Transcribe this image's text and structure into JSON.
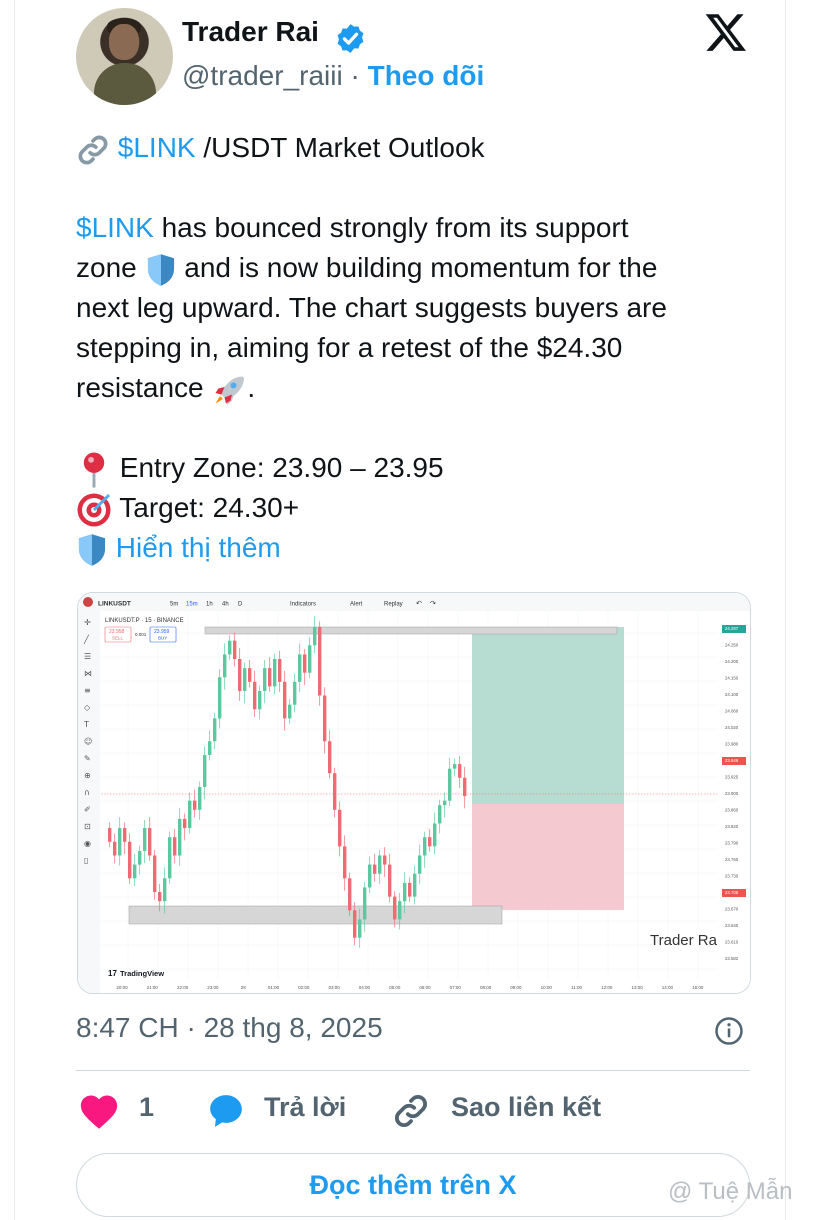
{
  "author": {
    "name": "Trader Rai",
    "handle": "@trader_raiii",
    "separator": "·",
    "follow_label": "Theo dõi"
  },
  "tweet": {
    "line1_cash": "$LINK",
    "line1_rest": " /USDT Market Outlook",
    "p1_cash": "$LINK",
    "p1_l1": " has bounced strongly from its support",
    "p1_l2a": "zone ",
    "p1_l2b": " and is now building momentum for the",
    "p1_l3": "next leg upward. The chart suggests buyers are",
    "p1_l4": "stepping in, aiming for a retest of the $24.30",
    "p1_l5a": "resistance ",
    "p1_l5b": ".",
    "entry": "Entry Zone: 23.90 – 23.95",
    "target": "Target: 24.30+",
    "show_more": "Hiển thị thêm"
  },
  "chart": {
    "symbol": "LINKUSDT",
    "intervals": [
      "5m",
      "15m",
      "1h",
      "4h",
      "D"
    ],
    "toolbar": {
      "indicators": "Indicators",
      "alert": "Alert",
      "replay": "Replay"
    },
    "legend": "LINKUSDT.P · 15 · BINANCE",
    "sell_price": "23.958",
    "sell_label": "SELL",
    "spread": "0.001",
    "buy_price": "23.959",
    "buy_label": "BUY",
    "price_axis": [
      "24.297",
      "24.250",
      "24.200",
      "24.150",
      "24.100",
      "24.060",
      "24.020",
      "23.980",
      "23.949",
      "23.925",
      "23.900",
      "23.860",
      "23.820",
      "23.790",
      "23.760",
      "23.730",
      "23.705",
      "23.670",
      "23.640",
      "23.610",
      "23.582"
    ],
    "time_axis": [
      "20:00",
      "21:00",
      "22:00",
      "23:00",
      "28",
      "01:00",
      "02:00",
      "03:00",
      "04:00",
      "05:00",
      "06:00",
      "07:00",
      "08:00",
      "09:00",
      "10:00",
      "11:00",
      "12:00",
      "13:00",
      "14:00",
      "15:00"
    ],
    "author_tag": "Trader Ra",
    "brand": "TradingView",
    "colors": {
      "up": "#5bc8a0",
      "down": "#ef6b73",
      "target_zone": "#b7dcd2",
      "stop_zone": "#f4c9cf"
    }
  },
  "timestamp": "8:47 CH · 28 thg 8, 2025",
  "actions": {
    "like_count": "1",
    "reply_label": "Trả lời",
    "copy_link_label": "Sao liên kết"
  },
  "read_more": "Đọc thêm trên X",
  "watermark": "@ Tuệ Mẫn"
}
